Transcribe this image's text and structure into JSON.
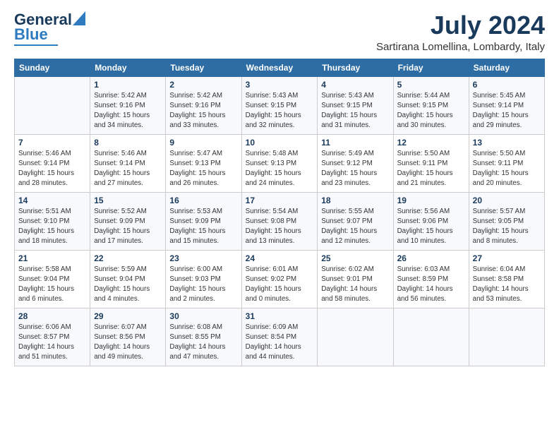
{
  "logo": {
    "line1": "General",
    "line2": "Blue"
  },
  "title": "July 2024",
  "subtitle": "Sartirana Lomellina, Lombardy, Italy",
  "weekdays": [
    "Sunday",
    "Monday",
    "Tuesday",
    "Wednesday",
    "Thursday",
    "Friday",
    "Saturday"
  ],
  "weeks": [
    [
      {
        "day": "",
        "info": ""
      },
      {
        "day": "1",
        "info": "Sunrise: 5:42 AM\nSunset: 9:16 PM\nDaylight: 15 hours\nand 34 minutes."
      },
      {
        "day": "2",
        "info": "Sunrise: 5:42 AM\nSunset: 9:16 PM\nDaylight: 15 hours\nand 33 minutes."
      },
      {
        "day": "3",
        "info": "Sunrise: 5:43 AM\nSunset: 9:15 PM\nDaylight: 15 hours\nand 32 minutes."
      },
      {
        "day": "4",
        "info": "Sunrise: 5:43 AM\nSunset: 9:15 PM\nDaylight: 15 hours\nand 31 minutes."
      },
      {
        "day": "5",
        "info": "Sunrise: 5:44 AM\nSunset: 9:15 PM\nDaylight: 15 hours\nand 30 minutes."
      },
      {
        "day": "6",
        "info": "Sunrise: 5:45 AM\nSunset: 9:14 PM\nDaylight: 15 hours\nand 29 minutes."
      }
    ],
    [
      {
        "day": "7",
        "info": "Sunrise: 5:46 AM\nSunset: 9:14 PM\nDaylight: 15 hours\nand 28 minutes."
      },
      {
        "day": "8",
        "info": "Sunrise: 5:46 AM\nSunset: 9:14 PM\nDaylight: 15 hours\nand 27 minutes."
      },
      {
        "day": "9",
        "info": "Sunrise: 5:47 AM\nSunset: 9:13 PM\nDaylight: 15 hours\nand 26 minutes."
      },
      {
        "day": "10",
        "info": "Sunrise: 5:48 AM\nSunset: 9:13 PM\nDaylight: 15 hours\nand 24 minutes."
      },
      {
        "day": "11",
        "info": "Sunrise: 5:49 AM\nSunset: 9:12 PM\nDaylight: 15 hours\nand 23 minutes."
      },
      {
        "day": "12",
        "info": "Sunrise: 5:50 AM\nSunset: 9:11 PM\nDaylight: 15 hours\nand 21 minutes."
      },
      {
        "day": "13",
        "info": "Sunrise: 5:50 AM\nSunset: 9:11 PM\nDaylight: 15 hours\nand 20 minutes."
      }
    ],
    [
      {
        "day": "14",
        "info": "Sunrise: 5:51 AM\nSunset: 9:10 PM\nDaylight: 15 hours\nand 18 minutes."
      },
      {
        "day": "15",
        "info": "Sunrise: 5:52 AM\nSunset: 9:09 PM\nDaylight: 15 hours\nand 17 minutes."
      },
      {
        "day": "16",
        "info": "Sunrise: 5:53 AM\nSunset: 9:09 PM\nDaylight: 15 hours\nand 15 minutes."
      },
      {
        "day": "17",
        "info": "Sunrise: 5:54 AM\nSunset: 9:08 PM\nDaylight: 15 hours\nand 13 minutes."
      },
      {
        "day": "18",
        "info": "Sunrise: 5:55 AM\nSunset: 9:07 PM\nDaylight: 15 hours\nand 12 minutes."
      },
      {
        "day": "19",
        "info": "Sunrise: 5:56 AM\nSunset: 9:06 PM\nDaylight: 15 hours\nand 10 minutes."
      },
      {
        "day": "20",
        "info": "Sunrise: 5:57 AM\nSunset: 9:05 PM\nDaylight: 15 hours\nand 8 minutes."
      }
    ],
    [
      {
        "day": "21",
        "info": "Sunrise: 5:58 AM\nSunset: 9:04 PM\nDaylight: 15 hours\nand 6 minutes."
      },
      {
        "day": "22",
        "info": "Sunrise: 5:59 AM\nSunset: 9:04 PM\nDaylight: 15 hours\nand 4 minutes."
      },
      {
        "day": "23",
        "info": "Sunrise: 6:00 AM\nSunset: 9:03 PM\nDaylight: 15 hours\nand 2 minutes."
      },
      {
        "day": "24",
        "info": "Sunrise: 6:01 AM\nSunset: 9:02 PM\nDaylight: 15 hours\nand 0 minutes."
      },
      {
        "day": "25",
        "info": "Sunrise: 6:02 AM\nSunset: 9:01 PM\nDaylight: 14 hours\nand 58 minutes."
      },
      {
        "day": "26",
        "info": "Sunrise: 6:03 AM\nSunset: 8:59 PM\nDaylight: 14 hours\nand 56 minutes."
      },
      {
        "day": "27",
        "info": "Sunrise: 6:04 AM\nSunset: 8:58 PM\nDaylight: 14 hours\nand 53 minutes."
      }
    ],
    [
      {
        "day": "28",
        "info": "Sunrise: 6:06 AM\nSunset: 8:57 PM\nDaylight: 14 hours\nand 51 minutes."
      },
      {
        "day": "29",
        "info": "Sunrise: 6:07 AM\nSunset: 8:56 PM\nDaylight: 14 hours\nand 49 minutes."
      },
      {
        "day": "30",
        "info": "Sunrise: 6:08 AM\nSunset: 8:55 PM\nDaylight: 14 hours\nand 47 minutes."
      },
      {
        "day": "31",
        "info": "Sunrise: 6:09 AM\nSunset: 8:54 PM\nDaylight: 14 hours\nand 44 minutes."
      },
      {
        "day": "",
        "info": ""
      },
      {
        "day": "",
        "info": ""
      },
      {
        "day": "",
        "info": ""
      }
    ]
  ]
}
